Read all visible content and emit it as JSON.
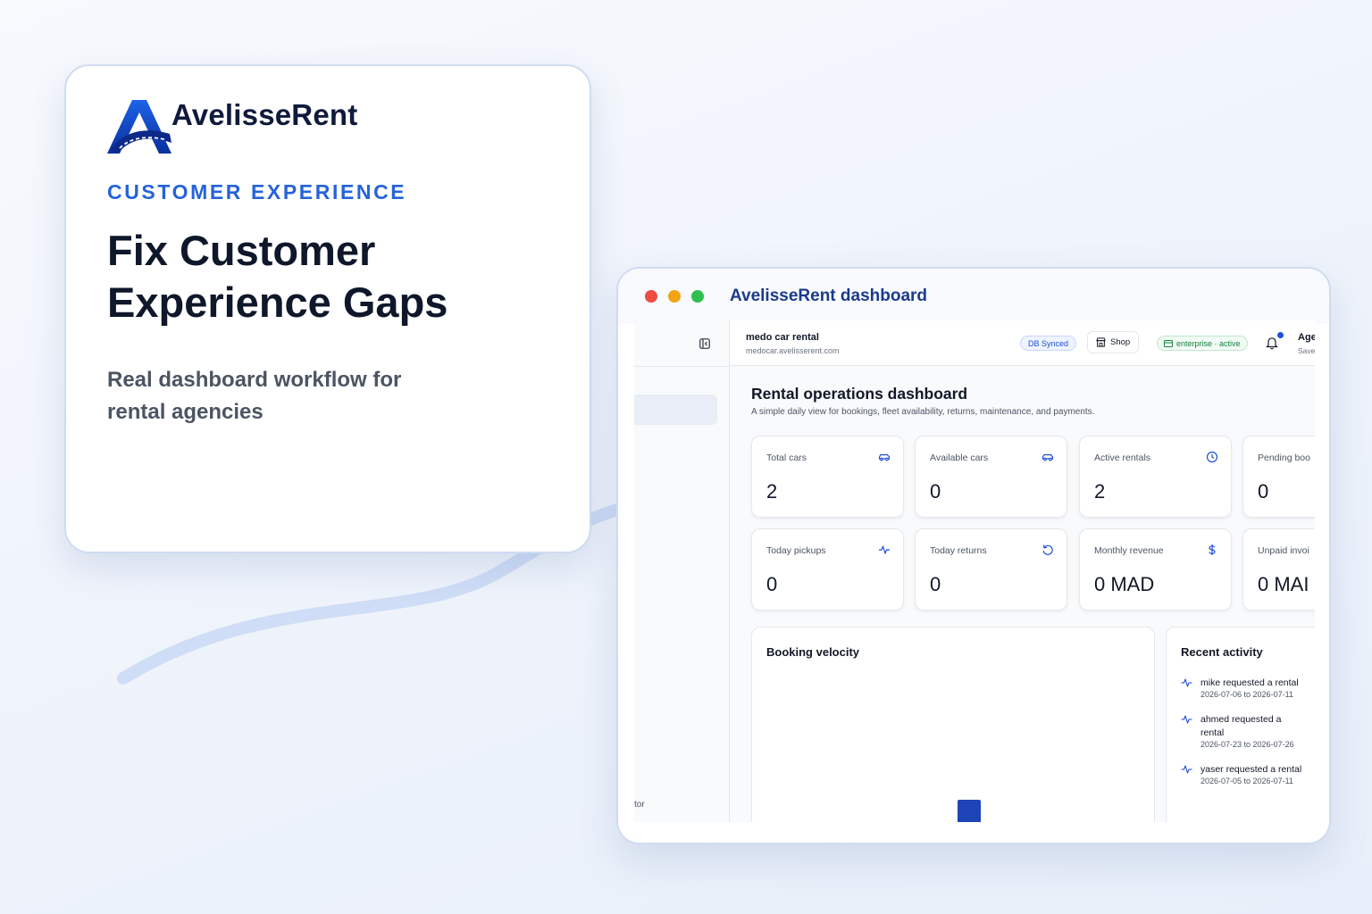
{
  "brand": {
    "name": "AvelisseRent",
    "accent_color": "#2563d9",
    "logo_icon": "road-a-logo-icon"
  },
  "promo": {
    "eyebrow": "CUSTOMER EXPERIENCE",
    "headline": "Fix Customer Experience Gaps",
    "subline": "Real dashboard workflow for rental agencies"
  },
  "window": {
    "title": "AvelisseRent dashboard",
    "controls": [
      "close",
      "minimize",
      "maximize"
    ]
  },
  "sidebar": {
    "collapse_icon": "sidebar-collapse-icon",
    "footer_text": "tor"
  },
  "header": {
    "org_name": "medo car rental",
    "org_domain": "medocar.avelisserent.com",
    "sync_badge": "DB Synced",
    "shop_label": "Shop",
    "plan_badge": "enterprise · active",
    "user_name": "Age",
    "user_role": "Save"
  },
  "page": {
    "title": "Rental operations dashboard",
    "subtitle": "A simple daily view for bookings, fleet availability, returns, maintenance, and payments."
  },
  "stats": [
    {
      "label": "Total cars",
      "value": "2",
      "icon": "car-icon"
    },
    {
      "label": "Available cars",
      "value": "0",
      "icon": "car-icon"
    },
    {
      "label": "Active rentals",
      "value": "2",
      "icon": "clock-icon"
    },
    {
      "label": "Pending boo",
      "value": "0",
      "icon": ""
    },
    {
      "label": "Today pickups",
      "value": "0",
      "icon": "activity-icon"
    },
    {
      "label": "Today returns",
      "value": "0",
      "icon": "rotate-icon"
    },
    {
      "label": "Monthly revenue",
      "value": "0 MAD",
      "icon": "dollar-icon"
    },
    {
      "label": "Unpaid invoi",
      "value": "0 MAI",
      "icon": ""
    }
  ],
  "booking_velocity": {
    "title": "Booking velocity",
    "bar_color": "#1d45b8"
  },
  "recent_activity": {
    "title": "Recent activity",
    "items": [
      {
        "text": "mike requested a rental",
        "dates": "2026-07-06 to 2026-07-11"
      },
      {
        "text": "ahmed requested a rental",
        "dates": "2026-07-23 to 2026-07-26"
      },
      {
        "text": "yaser requested a rental",
        "dates": "2026-07-05 to 2026-07-11"
      }
    ]
  }
}
